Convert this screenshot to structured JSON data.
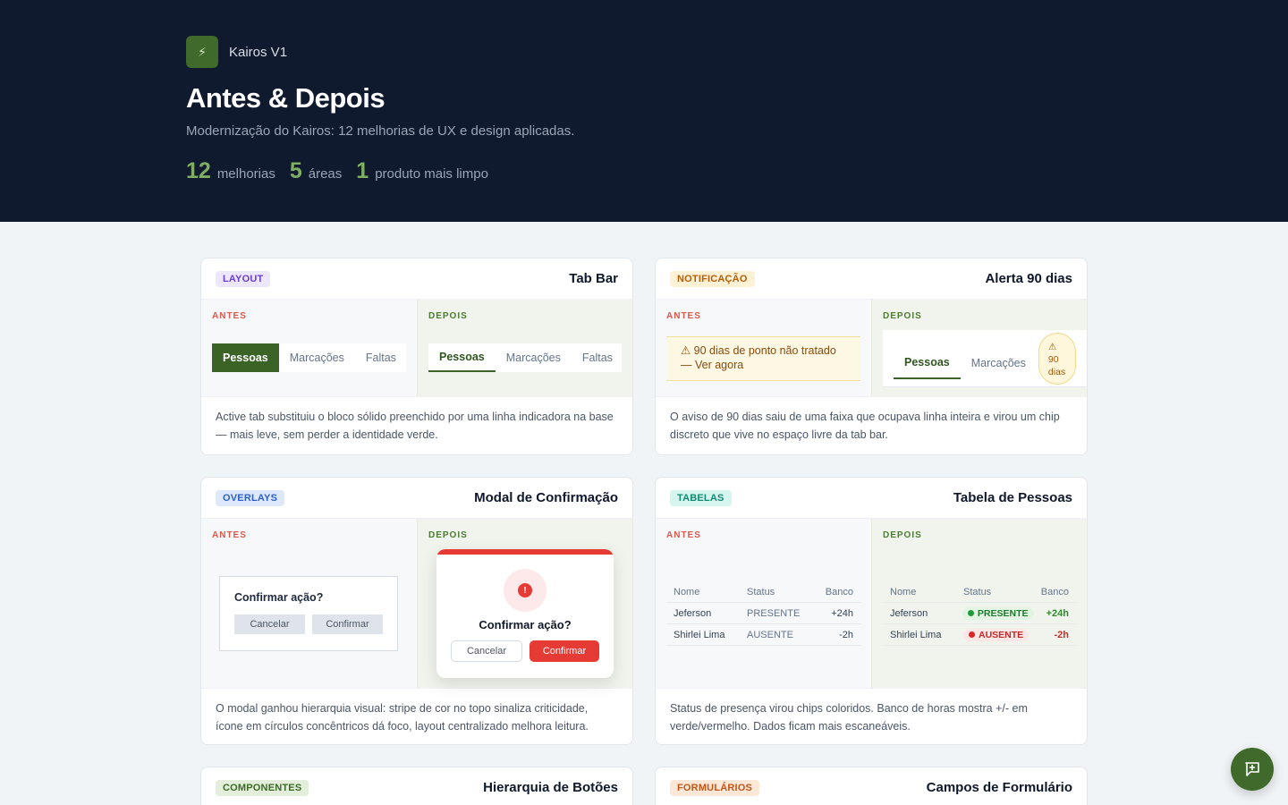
{
  "brand": {
    "icon": "lightning-icon",
    "name": "Kairos V1"
  },
  "hero": {
    "title": "Antes & Depois",
    "subtitle": "Modernização do Kairos: 12 melhorias de UX e design aplicadas.",
    "stats": [
      {
        "num": "12",
        "label": "melhorias"
      },
      {
        "num": "5",
        "label": "áreas"
      },
      {
        "num": "1",
        "label": "produto mais limpo"
      }
    ]
  },
  "labels": {
    "before": "ANTES",
    "after": "DEPOIS"
  },
  "cards": {
    "tabbar": {
      "tag": "LAYOUT",
      "title": "Tab Bar",
      "tabs": [
        "Pessoas",
        "Marcações",
        "Faltas"
      ],
      "desc": "Active tab substituiu o bloco sólido preenchido por uma linha indicadora na base — mais leve, sem perder a identidade verde."
    },
    "alert": {
      "tag": "NOTIFICAÇÃO",
      "title": "Alerta 90 dias",
      "before_text": "⚠ 90 dias de ponto não tratado — Ver agora",
      "tabs": [
        "Pessoas",
        "Marcações"
      ],
      "chip_icon": "⚠",
      "chip_line1": "90",
      "chip_line2": "dias",
      "desc": "O aviso de 90 dias saiu de uma faixa que ocupava linha inteira e virou um chip discreto que vive no espaço livre da tab bar."
    },
    "modal": {
      "tag": "OVERLAYS",
      "title": "Modal de Confirmação",
      "question": "Confirmar ação?",
      "cancel": "Cancelar",
      "confirm": "Confirmar",
      "icon_glyph": "!",
      "desc": "O modal ganhou hierarquia visual: stripe de cor no topo sinaliza criticidade, ícone em círculos concêntricos dá foco, layout centralizado melhora leitura."
    },
    "table": {
      "tag": "TABELAS",
      "title": "Tabela de Pessoas",
      "headers": [
        "Nome",
        "Status",
        "Banco"
      ],
      "rows": [
        {
          "name": "Jeferson",
          "status": "PRESENTE",
          "bank": "+24h"
        },
        {
          "name": "Shirlei Lima",
          "status": "AUSENTE",
          "bank": "-2h"
        }
      ],
      "desc": "Status de presença virou chips coloridos. Banco de horas mostra +/- em verde/vermelho. Dados ficam mais escaneáveis."
    },
    "buttons": {
      "tag": "COMPONENTES",
      "title": "Hierarquia de Botões"
    },
    "forms": {
      "tag": "FORMULÁRIOS",
      "title": "Campos de Formulário"
    }
  },
  "fab": {
    "icon": "feedback-icon"
  }
}
